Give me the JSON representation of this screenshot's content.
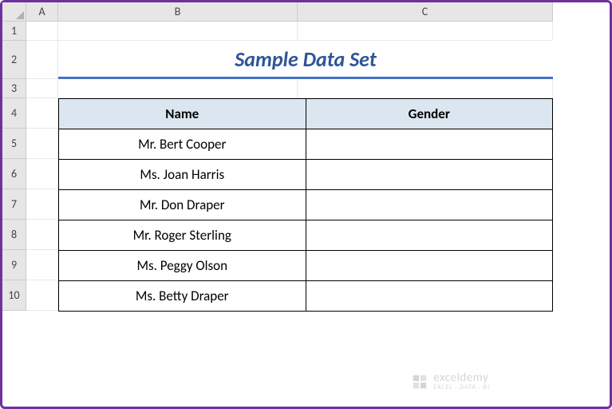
{
  "columns": [
    "A",
    "B",
    "C"
  ],
  "rows": [
    "1",
    "2",
    "3",
    "4",
    "5",
    "6",
    "7",
    "8",
    "9",
    "10"
  ],
  "title": "Sample Data Set",
  "table": {
    "headers": [
      "Name",
      "Gender"
    ],
    "data": [
      {
        "name": "Mr. Bert Cooper",
        "gender": ""
      },
      {
        "name": "Ms. Joan Harris",
        "gender": ""
      },
      {
        "name": "Mr. Don Draper",
        "gender": ""
      },
      {
        "name": "Mr. Roger Sterling",
        "gender": ""
      },
      {
        "name": "Ms. Peggy Olson",
        "gender": ""
      },
      {
        "name": "Ms. Betty Draper",
        "gender": ""
      }
    ]
  },
  "watermark": {
    "brand": "exceldemy",
    "sub": "EXCEL · DATA · BI"
  }
}
